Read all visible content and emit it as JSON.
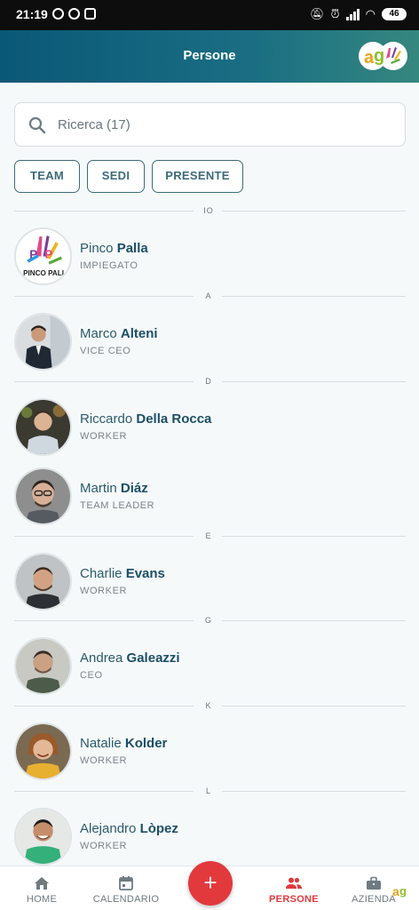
{
  "status_bar": {
    "time": "21:19",
    "battery": "46"
  },
  "app_bar": {
    "title": "Persone"
  },
  "search": {
    "placeholder": "Ricerca (17)"
  },
  "filters": [
    {
      "label": "TEAM"
    },
    {
      "label": "SEDI"
    },
    {
      "label": "PRESENTE"
    }
  ],
  "sections": {
    "io": "IO",
    "a": "A",
    "d": "D",
    "e": "E",
    "g": "G",
    "k": "K",
    "l": "L"
  },
  "people": [
    {
      "first": "Pinco",
      "last": "Palla",
      "role": "IMPIEGATO",
      "avatar": "pinco-palla-logo"
    },
    {
      "first": "Marco",
      "last": "Alteni",
      "role": "VICE CEO",
      "avatar": "photo"
    },
    {
      "first": "Riccardo",
      "last": "Della Rocca",
      "role": "WORKER",
      "avatar": "photo"
    },
    {
      "first": "Martin",
      "last": "Diáz",
      "role": "TEAM LEADER",
      "avatar": "photo"
    },
    {
      "first": "Charlie",
      "last": "Evans",
      "role": "WORKER",
      "avatar": "photo"
    },
    {
      "first": "Andrea",
      "last": "Galeazzi",
      "role": "CEO",
      "avatar": "photo"
    },
    {
      "first": "Natalie",
      "last": "Kolder",
      "role": "WORKER",
      "avatar": "photo"
    },
    {
      "first": "Alejandro",
      "last": "Lòpez",
      "role": "WORKER",
      "avatar": "photo"
    }
  ],
  "nav": {
    "home": "HOME",
    "calendar": "CALENDARIO",
    "add": "+",
    "people": "PERSONE",
    "company": "AZIENDA"
  },
  "colors": {
    "accent": "#e2393d",
    "header_start": "#0a5877",
    "header_end": "#35887e",
    "name_bold": "#1b4f66"
  }
}
